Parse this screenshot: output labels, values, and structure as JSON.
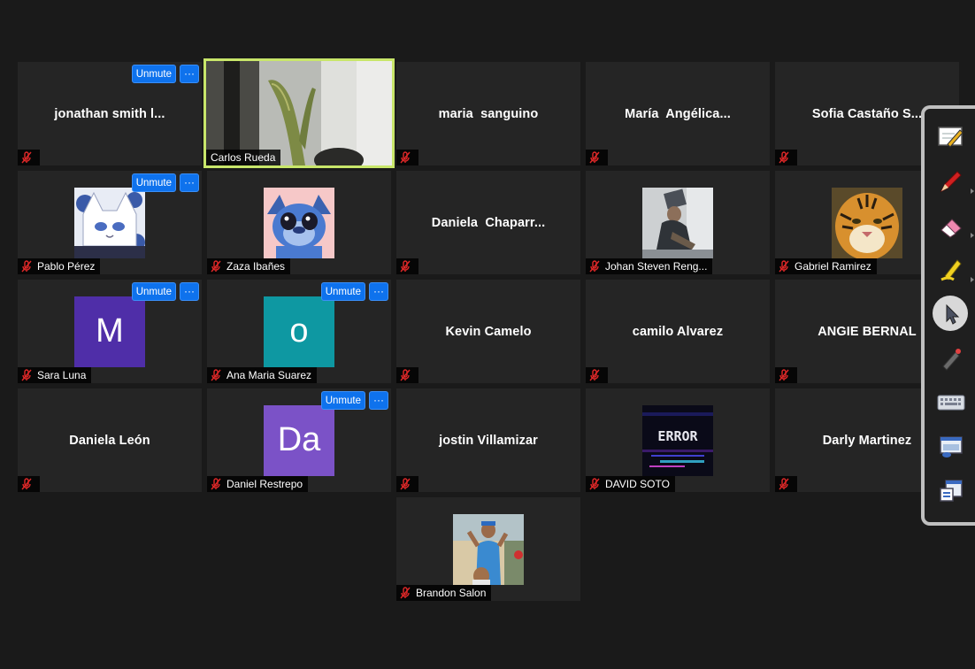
{
  "unmute_label": "Unmute",
  "more_label": "···",
  "colors": {
    "background": "#1a1a1a",
    "tile": "#252525",
    "active_speaker_border": "#c8e66a",
    "button_blue": "#0e72ed",
    "muted_red": "#e02828"
  },
  "participants": [
    {
      "id": "p1",
      "center_name": "jonathan smith l...",
      "name_label": "",
      "has_unmute": true
    },
    {
      "id": "p2",
      "center_name": "",
      "name_label": "Carlos Rueda",
      "active_speaker": true,
      "video": "cactus"
    },
    {
      "id": "p3",
      "center_name": "maria  sanguino",
      "name_label": ""
    },
    {
      "id": "p4",
      "center_name": "María  Angélica...",
      "name_label": ""
    },
    {
      "id": "p5",
      "center_name": "Sofia Castaño S...",
      "name_label": ""
    },
    {
      "id": "p6",
      "center_name": "",
      "name_label": "Pablo Pérez",
      "has_unmute": true,
      "avatar": "anime-cat"
    },
    {
      "id": "p7",
      "center_name": "",
      "name_label": "Zaza Ibañes",
      "avatar": "stitch"
    },
    {
      "id": "p8",
      "center_name": "Daniela  Chaparr...",
      "name_label": ""
    },
    {
      "id": "p9",
      "center_name": "",
      "name_label": "Johan Steven Reng...",
      "avatar": "person-photo"
    },
    {
      "id": "p10",
      "center_name": "",
      "name_label": "Gabriel Ramirez",
      "avatar": "tiger"
    },
    {
      "id": "p11",
      "center_name": "",
      "name_label": "Sara Luna",
      "has_unmute": true,
      "letter": "M",
      "letter_color": "#4f2ea8"
    },
    {
      "id": "p12",
      "center_name": "",
      "name_label": "Ana Maria Suarez",
      "has_unmute": true,
      "letter": "o",
      "letter_color": "#0e98a2"
    },
    {
      "id": "p13",
      "center_name": "Kevin Camelo",
      "name_label": ""
    },
    {
      "id": "p14",
      "center_name": "camilo Alvarez",
      "name_label": ""
    },
    {
      "id": "p15",
      "center_name": "ANGIE BERNAL",
      "name_label": ""
    },
    {
      "id": "p16",
      "center_name": "Daniela León",
      "name_label": ""
    },
    {
      "id": "p17",
      "center_name": "",
      "name_label": "Daniel Restrepo",
      "has_unmute": true,
      "letter": "Da",
      "letter_color": "#7b52c7"
    },
    {
      "id": "p18",
      "center_name": "jostin Villamizar",
      "name_label": ""
    },
    {
      "id": "p19",
      "center_name": "",
      "name_label": "DAVID SOTO",
      "avatar": "error-glitch",
      "avatar_text": "ERROR"
    },
    {
      "id": "p20",
      "center_name": "Darly Martinez",
      "name_label": ""
    },
    {
      "id": "p21",
      "center_name": "",
      "name_label": "Brandon Salon",
      "avatar": "selfie-photo"
    }
  ],
  "toolbar": {
    "tools": [
      "annotate-icon",
      "pen-icon",
      "eraser-icon",
      "highlighter-icon",
      "pointer-icon",
      "laser-icon",
      "keyboard-icon",
      "screen-capture-icon",
      "whiteboard-icon"
    ]
  }
}
